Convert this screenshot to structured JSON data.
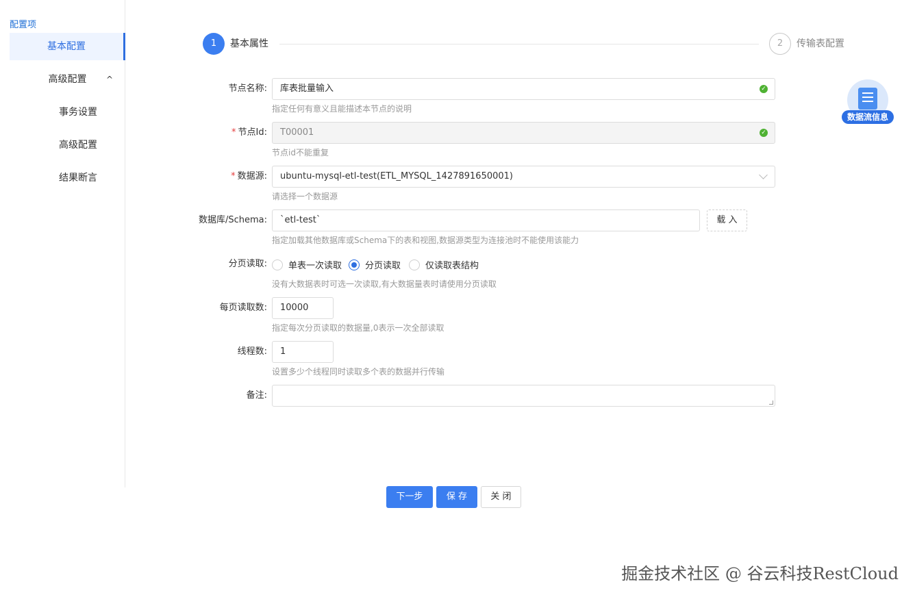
{
  "sidebar": {
    "title": "配置项",
    "items": [
      {
        "label": "基本配置"
      },
      {
        "label": "高级配置"
      },
      {
        "label": "事务设置"
      },
      {
        "label": "高级配置"
      },
      {
        "label": "结果断言"
      }
    ],
    "caret": "^"
  },
  "steps": [
    {
      "num": "1",
      "label": "基本属性"
    },
    {
      "num": "2",
      "label": "传输表配置"
    }
  ],
  "form": {
    "node_name": {
      "label": "节点名称:",
      "value": "库表批量输入",
      "hint": "指定任何有意义且能描述本节点的说明"
    },
    "node_id": {
      "label": "节点Id:",
      "value": "T00001",
      "hint": "节点id不能重复"
    },
    "datasource": {
      "label": "数据源:",
      "value": "ubuntu-mysql-etl-test(ETL_MYSQL_1427891650001)",
      "hint": "请选择一个数据源"
    },
    "schema": {
      "label": "数据库/Schema:",
      "value": "`etl-test`",
      "button": "载 入",
      "hint": "指定加载其他数据库或Schema下的表和视图,数据源类型为连接池时不能使用该能力"
    },
    "paging": {
      "label": "分页读取:",
      "options": [
        "单表一次读取",
        "分页读取",
        "仅读取表结构"
      ],
      "selected": "分页读取",
      "hint": "没有大数据表时可选一次读取,有大数据量表时请使用分页读取"
    },
    "page_size": {
      "label": "每页读取数:",
      "value": "10000",
      "hint": "指定每次分页读取的数据量,0表示一次全部读取"
    },
    "threads": {
      "label": "线程数:",
      "value": "1",
      "hint": "设置多少个线程同时读取多个表的数据并行传输"
    },
    "remark": {
      "label": "备注:",
      "value": ""
    }
  },
  "actions": {
    "next": "下一步",
    "save": "保 存",
    "close": "关 闭"
  },
  "float_info": {
    "label": "数据流信息"
  },
  "watermark": "掘金技术社区 @ 谷云科技RestCloud",
  "colors": {
    "primary": "#3b7ef0",
    "success": "#4fb233",
    "required": "#e43d3d"
  }
}
